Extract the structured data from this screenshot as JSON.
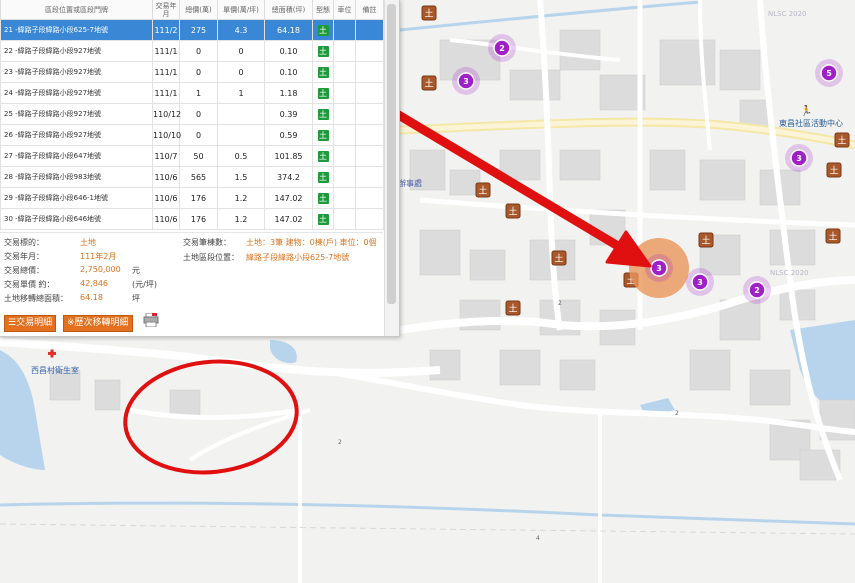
{
  "table": {
    "headers": [
      "區段位置或區段門牌",
      "交易年月",
      "總價(萬)",
      "單價(萬/坪)",
      "總面積(坪)",
      "型態",
      "車位",
      "備註"
    ],
    "rows": [
      {
        "addr": "21 -緯路子段緯路小段625-7地號",
        "ym": "111/2",
        "total": "275",
        "unit": "4.3",
        "area": "64.18",
        "type": "土"
      },
      {
        "addr": "22 -緯路子段緯路小段927地號",
        "ym": "111/1",
        "total": "0",
        "unit": "0",
        "area": "0.10",
        "type": "土"
      },
      {
        "addr": "23 -緯路子段緯路小段927地號",
        "ym": "111/1",
        "total": "0",
        "unit": "0",
        "area": "0.10",
        "type": "土"
      },
      {
        "addr": "24 -緯路子段緯路小段927地號",
        "ym": "111/1",
        "total": "1",
        "unit": "1",
        "area": "1.18",
        "type": "土"
      },
      {
        "addr": "25 -緯路子段緯路小段927地號",
        "ym": "110/12",
        "total": "0",
        "unit": "",
        "area": "0.39",
        "type": "土"
      },
      {
        "addr": "26 -緯路子段緯路小段927地號",
        "ym": "110/10",
        "total": "0",
        "unit": "",
        "area": "0.59",
        "type": "土"
      },
      {
        "addr": "27 -緯路子段緯路小段647地號",
        "ym": "110/7",
        "total": "50",
        "unit": "0.5",
        "area": "101.85",
        "type": "土"
      },
      {
        "addr": "28 -緯路子段緯路小段983地號",
        "ym": "110/6",
        "total": "565",
        "unit": "1.5",
        "area": "374.2",
        "type": "土"
      },
      {
        "addr": "29 -緯路子段緯路小段646-1地號",
        "ym": "110/6",
        "total": "176",
        "unit": "1.2",
        "area": "147.02",
        "type": "土"
      },
      {
        "addr": "30 -緯路子段緯路小段646地號",
        "ym": "110/6",
        "total": "176",
        "unit": "1.2",
        "area": "147.02",
        "type": "土"
      }
    ]
  },
  "info": {
    "target_label": "交易標的：",
    "target_value": "土地",
    "ym_label": "交易年月：",
    "ym_value": "111年2月",
    "total_label": "交易總價：",
    "total_value": "2,750,000",
    "total_unit": "元",
    "unit_label": "交易單價 約：",
    "unit_value": "42,846",
    "unit_unit": "(元/坪)",
    "area_label": "土地移轉總面積：",
    "area_value": "64.18",
    "area_unit": "坪",
    "count_label": "交易筆棟數：",
    "count_value": "土地：3筆 建物：0棟(戶) 車位：0個",
    "loc_label": "土地區段位置：",
    "loc_value": "緯路子段緯路小段625-7地號",
    "btn_detail": "交易明細",
    "btn_history": "※歷次移轉明細"
  },
  "map": {
    "clusters": [
      {
        "n": "2"
      },
      {
        "n": "3"
      },
      {
        "n": "5"
      },
      {
        "n": "3"
      },
      {
        "n": "3"
      },
      {
        "n": "2"
      },
      {
        "n": "3"
      }
    ],
    "selected": "3",
    "marker_glyph": "土",
    "labels": {
      "community": "東昌社區活動中心",
      "clinic": "西昌村衛生室",
      "office": "辦事處",
      "watermark1": "NLSC 2020",
      "watermark2": "NLSC 2020",
      "road_mark1": "2",
      "road_mark2": "4",
      "road_mark3": "2",
      "road_mark4": "2"
    },
    "colors": {
      "cluster": "#a020c8",
      "selected": "#e8955a",
      "arrow": "#e01010",
      "ellipse": "#e01010",
      "water": "#b8d4ec",
      "road_yellow": "#f5e7a6"
    }
  }
}
